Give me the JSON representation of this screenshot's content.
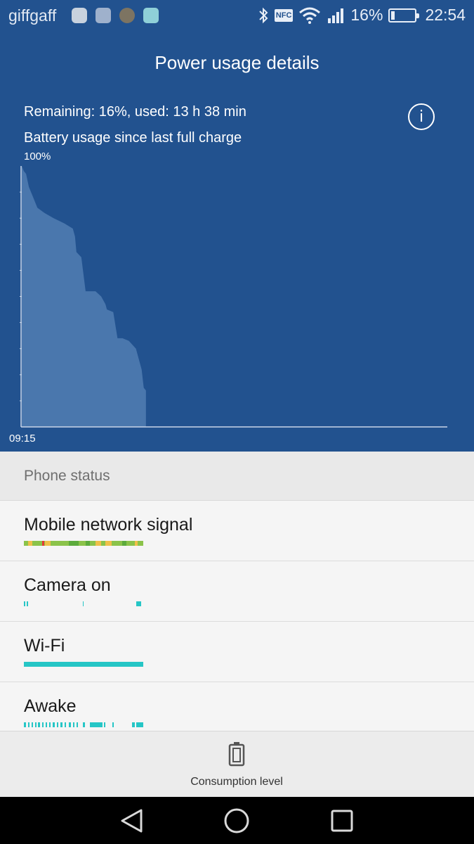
{
  "status_bar": {
    "carrier": "giffgaff",
    "nfc": "NFC",
    "battery_percent": "16%",
    "time": "22:54",
    "battery_level": 0.16
  },
  "header": {
    "title": "Power usage details",
    "remaining": "Remaining: 16%, used: 13 h 38 min",
    "subtitle": "Battery usage since last full charge",
    "info_icon": "info-icon",
    "info_glyph": "i"
  },
  "chart_data": {
    "type": "area",
    "y_label_top": "100%",
    "x_start_label": "09:15",
    "ylim": [
      0,
      100
    ],
    "color": "#4a77ad",
    "x_hours": [
      0,
      0.3,
      0.6,
      1.0,
      1.6,
      2.2,
      3.2,
      4.5,
      6.0,
      7.2,
      7.5,
      7.7,
      8.4,
      9.0,
      9.6,
      10.4,
      11.2,
      11.8,
      12.0,
      12.9,
      13.5,
      14.2,
      15.1,
      16.1,
      16.3,
      16.9,
      17.2,
      17.5
    ],
    "y_values": [
      100,
      98,
      97,
      92,
      88,
      84,
      82,
      80,
      78,
      76,
      73,
      67,
      65,
      52,
      52,
      52,
      50,
      47,
      45,
      44,
      34,
      34,
      33,
      30,
      28,
      22,
      15,
      14
    ],
    "x_max_hours": 60
  },
  "phone_status": {
    "title": "Phone status",
    "rows": [
      {
        "label": "Mobile network signal"
      },
      {
        "label": "Camera on"
      },
      {
        "label": "Wi-Fi"
      },
      {
        "label": "Awake"
      }
    ],
    "colors": {
      "good": "#8bc34a",
      "mid": "#f0c04a",
      "poor": "#e53935",
      "dark_green": "#5cab3c",
      "teal": "#26c6c6"
    }
  },
  "bottom_bar": {
    "consumption_label": "Consumption level",
    "icon": "battery-icon"
  },
  "nav_bar": {
    "back_icon": "back-icon",
    "home_icon": "home-icon",
    "recents_icon": "recents-icon"
  }
}
